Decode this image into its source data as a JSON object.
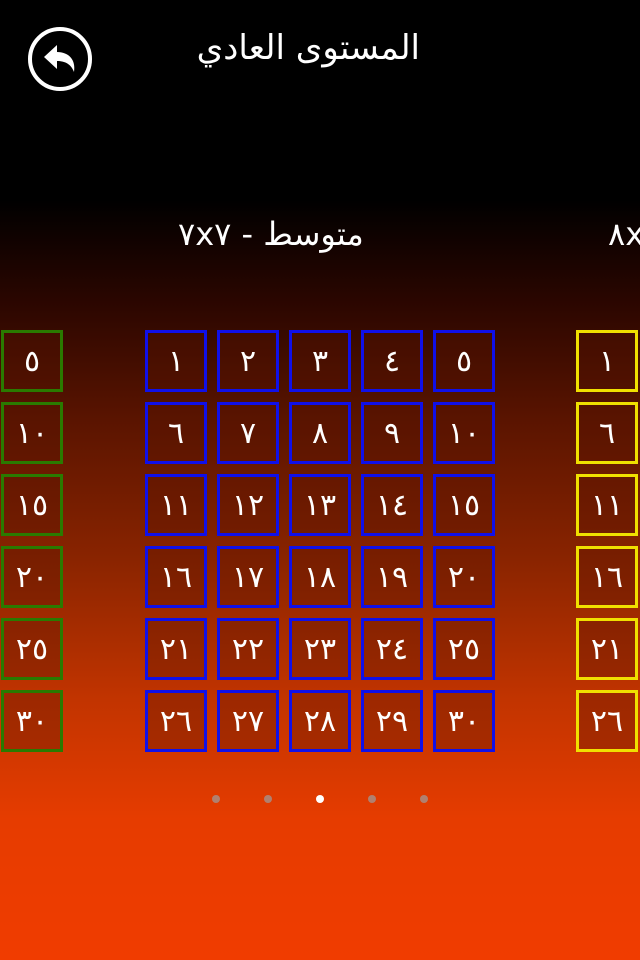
{
  "header": {
    "title": "المستوى العادي",
    "back_icon": "back-arrow-icon"
  },
  "pages": {
    "current": {
      "label": "متوسط - ٧x٧",
      "border_color": "#1010e8",
      "levels": [
        "١",
        "٢",
        "٣",
        "٤",
        "٥",
        "٦",
        "٧",
        "٨",
        "٩",
        "١٠",
        "١١",
        "١٢",
        "١٣",
        "١٤",
        "١٥",
        "١٦",
        "١٧",
        "١٨",
        "١٩",
        "٢٠",
        "٢١",
        "٢٢",
        "٢٣",
        "٢٤",
        "٢٥",
        "٢٦",
        "٢٧",
        "٢٨",
        "٢٩",
        "٣٠"
      ]
    },
    "previous": {
      "border_color": "#2a7a00",
      "levels_visible": [
        "٥",
        "١٠",
        "١٥",
        "٢٠",
        "٢٥",
        "٣٠"
      ]
    },
    "next": {
      "label": "٨x",
      "border_color": "#f0e000",
      "levels_visible": [
        "١",
        "٦",
        "١١",
        "١٦",
        "٢١",
        "٢٦"
      ]
    }
  },
  "pagination": {
    "count": 5,
    "active_index": 2
  }
}
